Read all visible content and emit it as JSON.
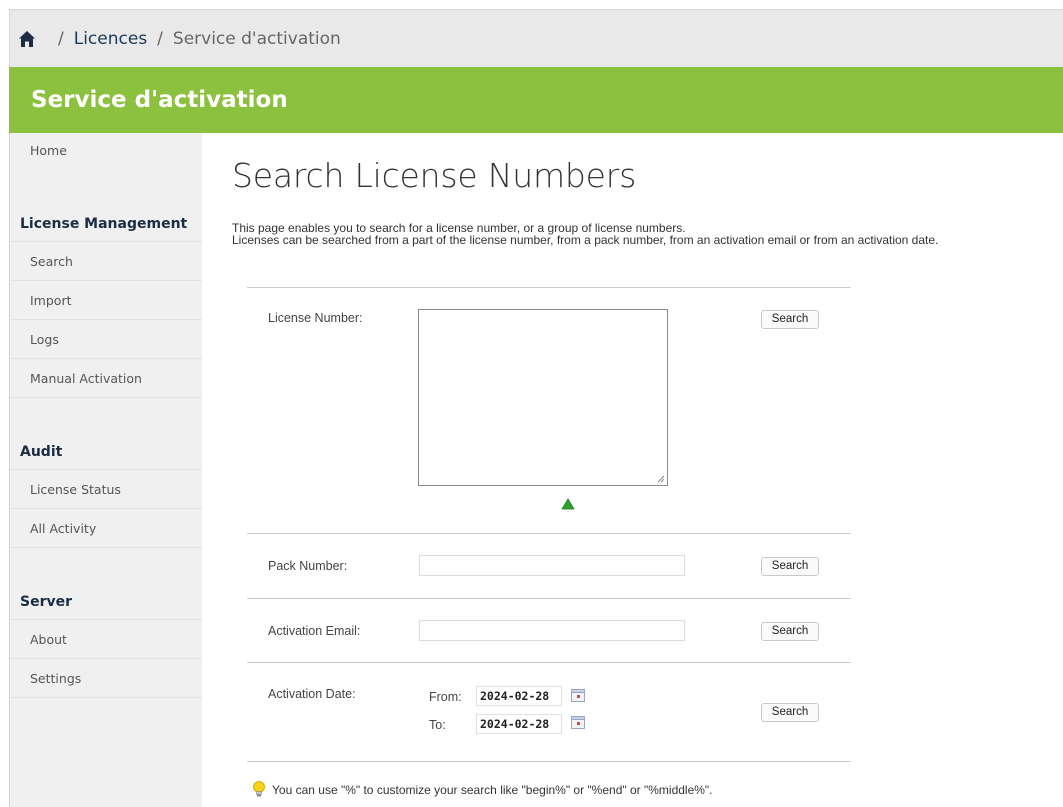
{
  "breadcrumb": {
    "home_icon": "home-icon",
    "link": "Licences",
    "current": "Service d'activation",
    "separator": "/"
  },
  "app_title": "Service d'activation",
  "sidebar": {
    "home": "Home",
    "groups": [
      {
        "title": "License Management",
        "items": [
          "Search",
          "Import",
          "Logs",
          "Manual Activation"
        ]
      },
      {
        "title": "Audit",
        "items": [
          "License Status",
          "All Activity"
        ]
      },
      {
        "title": "Server",
        "items": [
          "About",
          "Settings"
        ]
      }
    ]
  },
  "main": {
    "title": "Search License Numbers",
    "description_line1": "This page enables you to search for a license number, or a group of license numbers.",
    "description_line2": "Licenses can be searched from a part of the license number, from a pack number, from an activation email or from an activation date.",
    "license_number": {
      "label": "License Number:",
      "value": "",
      "button": "Search"
    },
    "pack_number": {
      "label": "Pack Number:",
      "value": "",
      "button": "Search"
    },
    "activation_email": {
      "label": "Activation Email:",
      "value": "",
      "button": "Search"
    },
    "activation_date": {
      "label": "Activation Date:",
      "from_label": "From:",
      "from_value": "2024-02-28",
      "to_label": "To:",
      "to_value": "2024-02-28",
      "button": "Search"
    },
    "hint": "You can use \"%\" to customize your search like \"begin%\" or \"%end\" or \"%middle%\"."
  },
  "colors": {
    "brand_green": "#8cc13f",
    "breadcrumb_bg": "#e9e9e9",
    "sidebar_bg": "#f0f0f0",
    "heading_navy": "#1a2d45"
  }
}
